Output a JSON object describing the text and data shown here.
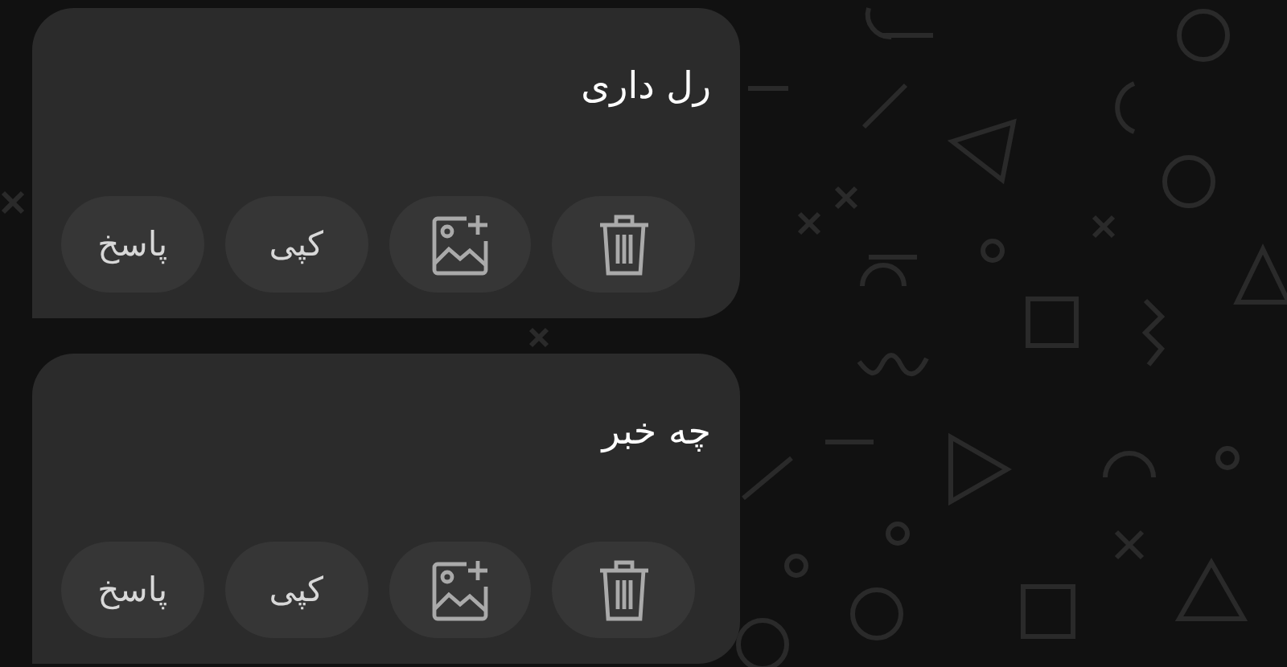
{
  "messages": [
    {
      "text": "رل داری",
      "actions": [
        {
          "kind": "delete"
        },
        {
          "kind": "add-image"
        },
        {
          "kind": "copy",
          "label": "کپی"
        },
        {
          "kind": "reply",
          "label": "پاسخ"
        }
      ]
    },
    {
      "text": "چه خبر",
      "actions": [
        {
          "kind": "delete"
        },
        {
          "kind": "add-image"
        },
        {
          "kind": "copy",
          "label": "کپی"
        },
        {
          "kind": "reply",
          "label": "پاسخ"
        }
      ]
    }
  ]
}
